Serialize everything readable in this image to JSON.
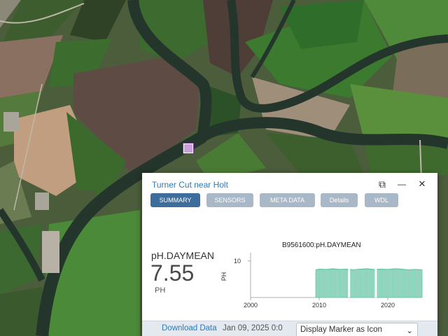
{
  "panel": {
    "title": "Turner Cut near Holt",
    "controls": {
      "popout": "⧉",
      "minimize": "—",
      "close": "✕"
    }
  },
  "tabs": [
    {
      "label": "SUMMARY",
      "active": true
    },
    {
      "label": "SENSORS",
      "active": false
    },
    {
      "label": "META DATA",
      "active": false
    },
    {
      "label": "Details",
      "active": false
    },
    {
      "label": "WDL",
      "active": false
    }
  ],
  "summary": {
    "name": "pH.DAYMEAN",
    "value": "7.55",
    "unit": "PH"
  },
  "footer": {
    "download_label": "Download Data",
    "date": "Jan 09, 2025 0:0",
    "marker_option": "Display Marker as Icon",
    "chevron": "⌄"
  },
  "colors": {
    "accent": "#2c7bb6",
    "tab_active": "#3d6d9c",
    "tab_inactive": "#a9b8c7",
    "series": "#86d1b8",
    "marker": "#c9a0dc"
  },
  "chart_data": {
    "type": "area",
    "title": "B9561600:pH.DAYMEAN",
    "ylabel": "PH",
    "xlabel": "",
    "x_ticks": [
      "2000",
      "2010",
      "2020"
    ],
    "y_ticks": [
      "10"
    ],
    "xlim": [
      2000,
      2025
    ],
    "ylim": [
      0,
      11.5
    ],
    "grid": false,
    "series": [
      {
        "x": [
          2009.5,
          2010,
          2011,
          2012,
          2013,
          2014,
          2015,
          2016,
          2017,
          2018,
          2019,
          2020,
          2021,
          2022,
          2023,
          2024,
          2025
        ],
        "values": [
          7.6,
          7.8,
          7.7,
          7.9,
          7.7,
          7.8,
          7.6,
          7.8,
          7.9,
          7.7,
          7.8,
          7.7,
          7.9,
          7.8,
          7.6,
          7.7,
          7.6
        ]
      }
    ]
  }
}
